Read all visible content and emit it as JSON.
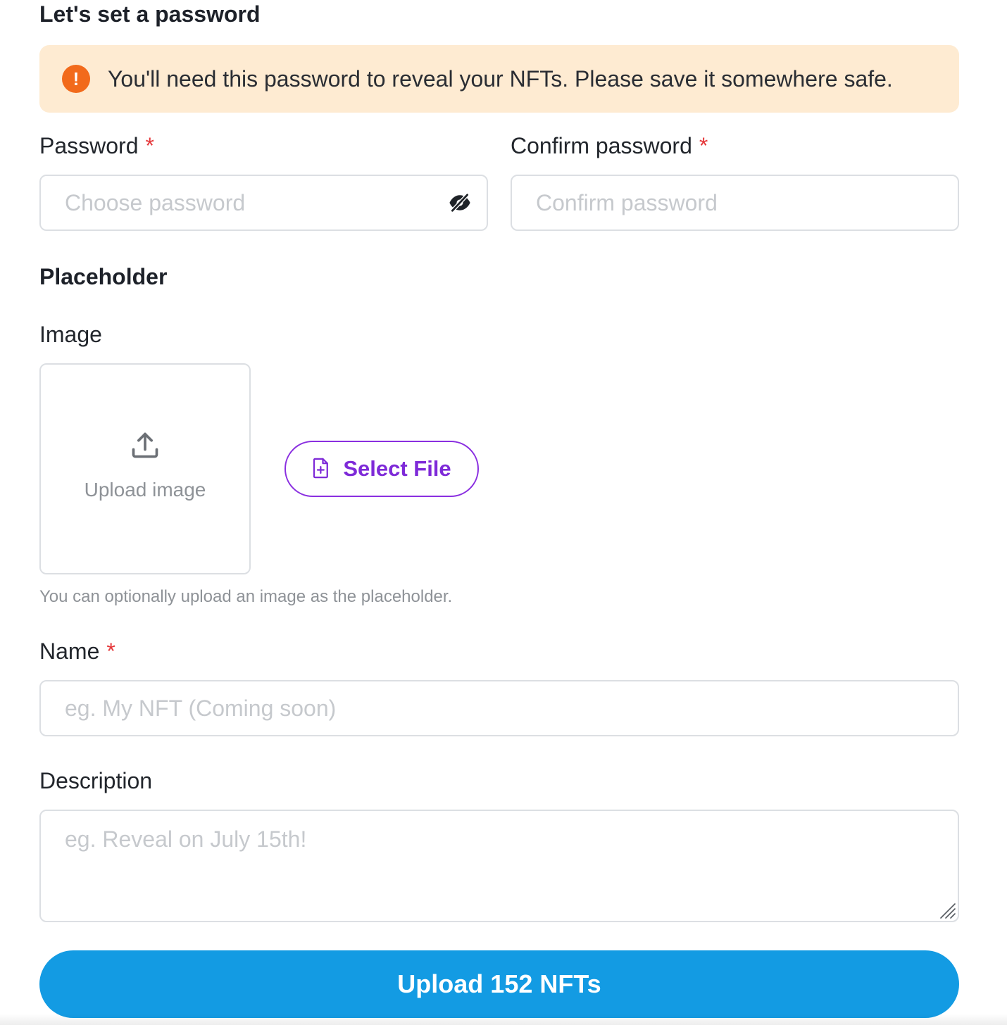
{
  "password_section": {
    "title": "Let's set a password",
    "alert": {
      "icon": "exclamation-circle-icon",
      "icon_glyph": "!",
      "text": "You'll need this password to reveal your NFTs. Please save it somewhere safe."
    },
    "password": {
      "label": "Password",
      "required_mark": "*",
      "placeholder": "Choose password",
      "value": "",
      "toggle_icon": "eye-off-icon"
    },
    "confirm": {
      "label": "Confirm password",
      "required_mark": "*",
      "placeholder": "Confirm password",
      "value": ""
    }
  },
  "placeholder_section": {
    "title": "Placeholder",
    "image": {
      "label": "Image",
      "upload_text": "Upload image",
      "upload_icon": "upload-icon",
      "select_button": {
        "label": "Select File",
        "icon": "file-plus-icon"
      },
      "help": "You can optionally upload an image as the placeholder."
    },
    "name": {
      "label": "Name",
      "required_mark": "*",
      "placeholder": "eg. My NFT (Coming soon)",
      "value": ""
    },
    "description": {
      "label": "Description",
      "placeholder": "eg. Reveal on July 15th!",
      "value": ""
    }
  },
  "submit": {
    "label": "Upload 152 NFTs"
  },
  "colors": {
    "accent": "#139be3",
    "select_accent": "#7e2ad8",
    "alert_bg": "#feebd2",
    "alert_icon": "#f26a1b",
    "required": "#e5383b"
  }
}
